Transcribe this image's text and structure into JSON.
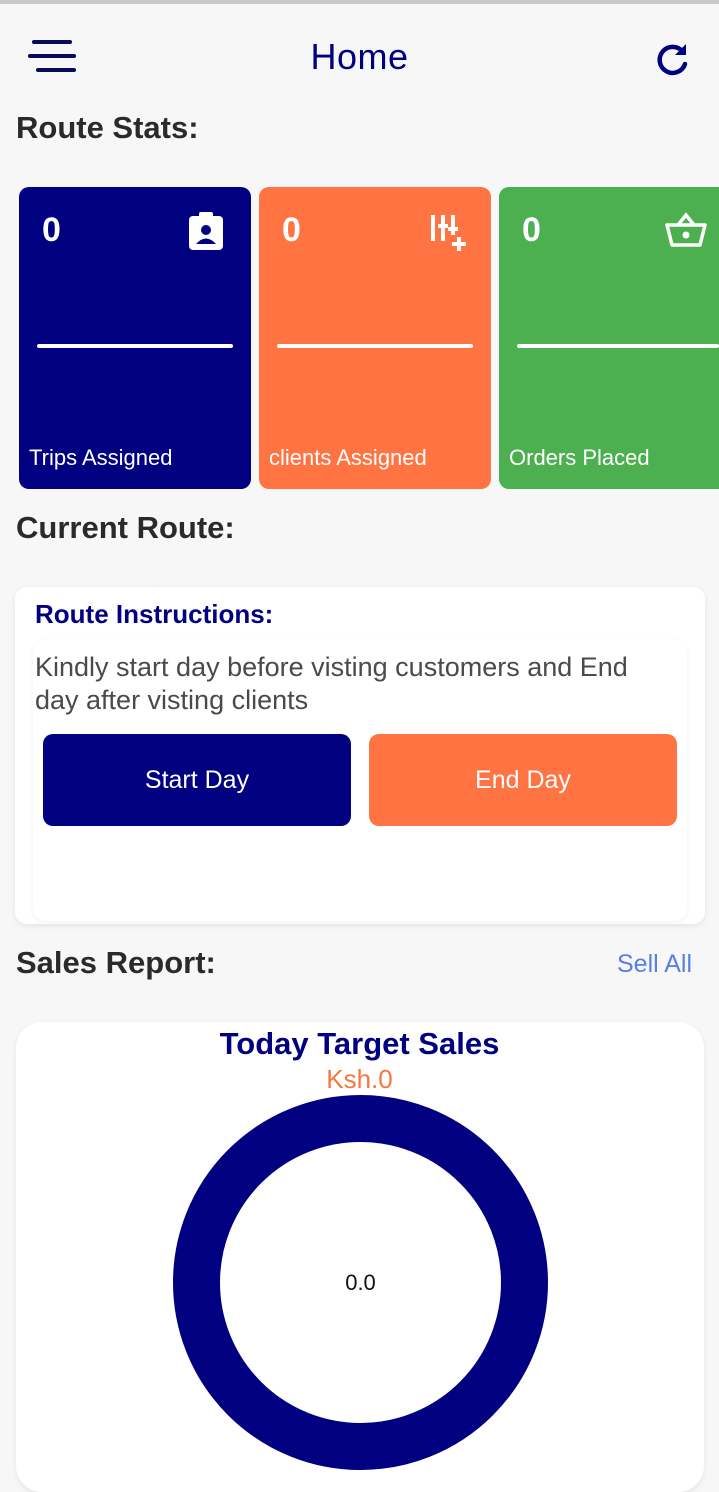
{
  "header": {
    "title": "Home"
  },
  "route_stats": {
    "heading": "Route Stats:",
    "cards": [
      {
        "value": "0",
        "label": "Trips Assigned",
        "color": "#000080",
        "icon": "clipboard-user-icon"
      },
      {
        "value": "0",
        "label": "clients Assigned",
        "color": "#ff7442",
        "icon": "list-add-icon"
      },
      {
        "value": "0",
        "label": "Orders Placed",
        "color": "#4caf50",
        "icon": "basket-icon"
      }
    ]
  },
  "current_route": {
    "heading": "Current Route:",
    "instructions_title": "Route Instructions:",
    "instructions_text": "Kindly start day before visting customers and End day after visting clients",
    "start_label": "Start Day",
    "end_label": "End Day"
  },
  "sales_report": {
    "heading": "Sales Report:",
    "sell_all": "Sell All",
    "target_title": "Today Target Sales",
    "target_value": "Ksh.0",
    "center_value": "0.0",
    "ring_color": "#000080"
  },
  "colors": {
    "primary": "#000080",
    "accent": "#ff7442",
    "success": "#4caf50",
    "link": "#5b7fe0"
  }
}
